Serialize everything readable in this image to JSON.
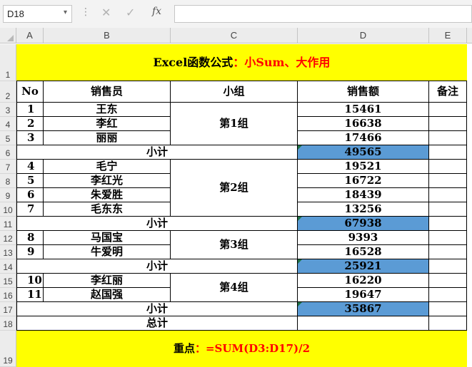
{
  "name_box": {
    "value": "D18",
    "dropdown_icon": "chevron-down-icon"
  },
  "formula_bar": {
    "cancel_icon": "x-icon",
    "enter_icon": "check-icon",
    "fx_label": "fx",
    "formula": ""
  },
  "columns": [
    "A",
    "B",
    "C",
    "D",
    "E"
  ],
  "rows": [
    "1",
    "2",
    "3",
    "4",
    "5",
    "6",
    "7",
    "8",
    "9",
    "10",
    "11",
    "12",
    "13",
    "14",
    "15",
    "16",
    "17",
    "18",
    "19"
  ],
  "title": {
    "prefix": "Excel函数公式",
    "colon": "：",
    "emphasis": "小Sum、大作用"
  },
  "headers": {
    "no": "No",
    "salesperson": "销售员",
    "group": "小组",
    "sales": "销售额",
    "remark": "备注"
  },
  "data_rows": [
    {
      "no": "1",
      "name": "王东",
      "sales": "15461"
    },
    {
      "no": "2",
      "name": "李红",
      "sales": "16638"
    },
    {
      "no": "3",
      "name": "丽丽",
      "sales": "17466"
    },
    {
      "no": "4",
      "name": "毛宁",
      "sales": "19521"
    },
    {
      "no": "5",
      "name": "李红光",
      "sales": "16722"
    },
    {
      "no": "6",
      "name": "朱爱胜",
      "sales": "18439"
    },
    {
      "no": "7",
      "name": "毛东东",
      "sales": "13256"
    },
    {
      "no": "8",
      "name": "马国宝",
      "sales": "9393"
    },
    {
      "no": "9",
      "name": "牛爱明",
      "sales": "16528"
    },
    {
      "no": "10",
      "name": "李红丽",
      "sales": "16220"
    },
    {
      "no": "11",
      "name": "赵国强",
      "sales": "19647"
    }
  ],
  "groups": [
    "第1组",
    "第2组",
    "第3组",
    "第4组"
  ],
  "subtotal_label": "小计",
  "subtotals": [
    "49565",
    "67938",
    "25921",
    "35867"
  ],
  "total_label": "总计",
  "total_value": "",
  "note": {
    "label": "重点",
    "colon": "：",
    "formula": "=SUM(D3:D17)/2"
  },
  "colors": {
    "highlight": "#FFFF00",
    "subtotal_fill": "#5B9BD5",
    "accent_text": "#FF0000"
  }
}
